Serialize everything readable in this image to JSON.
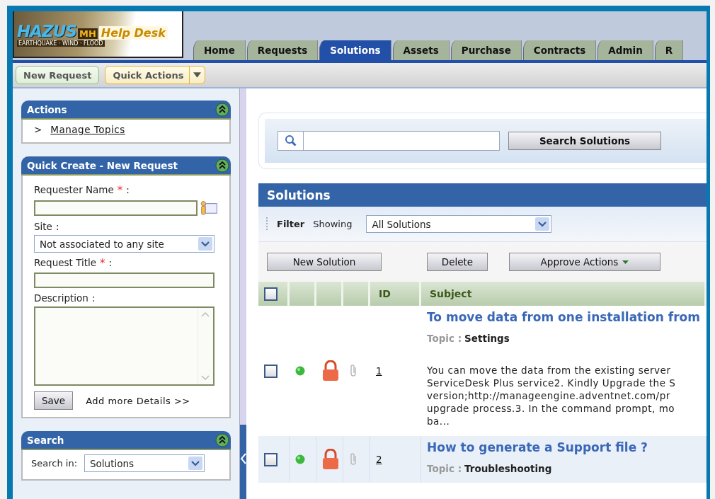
{
  "logo": {
    "title": "HAZUS",
    "badge": "MH",
    "subtitle": "Help Desk",
    "tagline": "EARTHQUAKE · WIND · FLOOD"
  },
  "tabs": [
    {
      "label": "Home",
      "selected": false
    },
    {
      "label": "Requests",
      "selected": false
    },
    {
      "label": "Solutions",
      "selected": true
    },
    {
      "label": "Assets",
      "selected": false
    },
    {
      "label": "Purchase",
      "selected": false
    },
    {
      "label": "Contracts",
      "selected": false
    },
    {
      "label": "Admin",
      "selected": false
    },
    {
      "label": "R",
      "selected": false
    }
  ],
  "toolbar": {
    "new_request": "New Request",
    "quick_actions": "Quick Actions"
  },
  "sidebar": {
    "actions": {
      "title": "Actions",
      "links": [
        {
          "marker": ">",
          "label": "Manage Topics"
        }
      ]
    },
    "quick_create": {
      "title": "Quick Create - New Request",
      "fields": [
        {
          "kind": "person",
          "label": "Requester Name",
          "required": true,
          "suffix": ":"
        },
        {
          "kind": "select",
          "label": "Site",
          "required": false,
          "suffix": ":",
          "value": "Not associated to any site"
        },
        {
          "kind": "text",
          "label": "Request Title",
          "required": true,
          "suffix": ":"
        },
        {
          "kind": "textarea",
          "label": "Description",
          "required": false,
          "suffix": ":"
        }
      ],
      "required_mark": "*",
      "save": "Save",
      "more": "Add more Details >>"
    },
    "search": {
      "title": "Search",
      "label": "Search in:",
      "value": "Solutions"
    }
  },
  "main": {
    "search_button": "Search Solutions",
    "solutions": {
      "title": "Solutions",
      "filter_label": "Filter",
      "showing_label": "Showing",
      "filter_value": "All Solutions",
      "buttons": [
        {
          "kind": "plain",
          "label": "New Solution"
        },
        {
          "kind": "plain",
          "label": "Delete"
        },
        {
          "kind": "menu",
          "label": "Approve Actions"
        }
      ],
      "select_all_checked": false,
      "columns": [
        "ID",
        "Subject"
      ],
      "rows": [
        {
          "checked": false,
          "id": "1",
          "title": "To move data from one installation from",
          "topic_label": "Topic :",
          "topic": "Settings",
          "description_lines": [
            "You can move the data from the existing server",
            "ServiceDesk Plus service2. Kindly Upgrade the S",
            "version;http://manageengine.adventnet.com/pr",
            "upgrade process.3. In the command prompt, mo",
            "ba..."
          ]
        },
        {
          "checked": false,
          "id": "2",
          "title": "How to generate a Support file ?",
          "topic_label": "Topic :",
          "topic": "Troubleshooting",
          "description_lines": []
        }
      ]
    }
  }
}
